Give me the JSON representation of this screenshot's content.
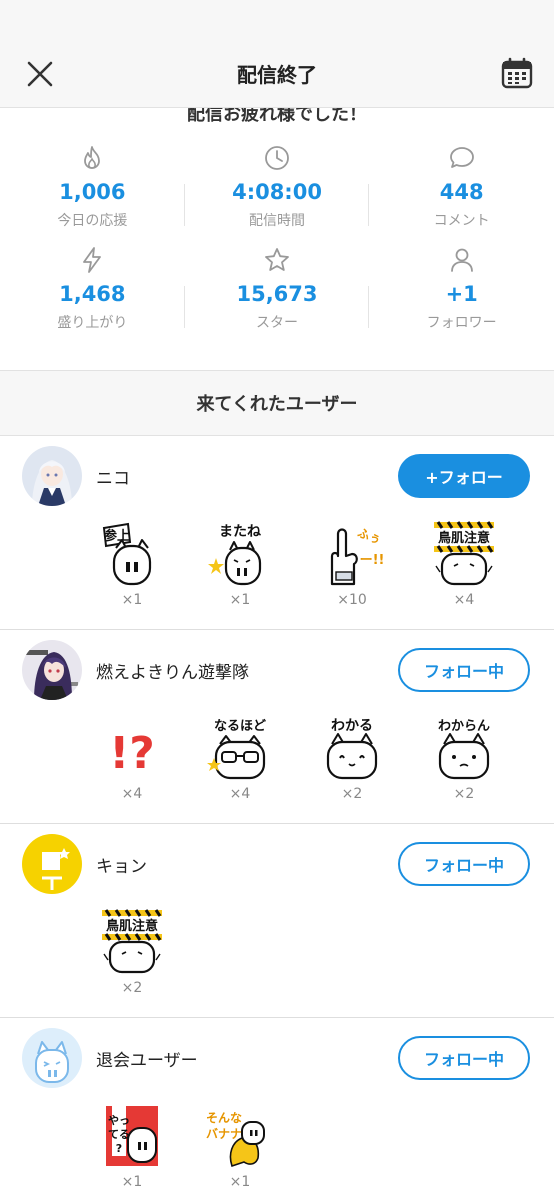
{
  "header": {
    "title": "配信終了"
  },
  "summary": {
    "banner": "配信お疲れ様でした！",
    "stats": [
      {
        "icon": "fire-icon",
        "value": "1,006",
        "label": "今日の応援"
      },
      {
        "icon": "clock-icon",
        "value": "4:08:00",
        "label": "配信時間"
      },
      {
        "icon": "comment-icon",
        "value": "448",
        "label": "コメント"
      },
      {
        "icon": "lightning-icon",
        "value": "1,468",
        "label": "盛り上がり"
      },
      {
        "icon": "star-icon",
        "value": "15,673",
        "label": "スター"
      },
      {
        "icon": "person-icon",
        "value": "+1",
        "label": "フォロワー"
      }
    ]
  },
  "visitors": {
    "title": "来てくれたユーザー",
    "users": [
      {
        "name": "ニコ",
        "follow_label": "+フォロー",
        "stickers": [
          {
            "name": "sticker-sanjou",
            "text": "参上",
            "count": "×1"
          },
          {
            "name": "sticker-matane",
            "text": "またね",
            "count": "×1"
          },
          {
            "name": "sticker-fuu",
            "text": "ふぅー!!",
            "count": "×10"
          },
          {
            "name": "sticker-torihada",
            "text": "鳥肌注意",
            "count": "×4"
          }
        ]
      },
      {
        "name": "燃えよきりん遊撃隊",
        "follow_label": "フォロー中",
        "stickers": [
          {
            "name": "sticker-exclaim",
            "text": "!?",
            "count": "×4"
          },
          {
            "name": "sticker-naruhodo",
            "text": "なるほど",
            "count": "×4"
          },
          {
            "name": "sticker-wakaru",
            "text": "わかる",
            "count": "×2"
          },
          {
            "name": "sticker-wakaran",
            "text": "わからん",
            "count": "×2"
          }
        ]
      },
      {
        "name": "キョン",
        "follow_label": "フォロー中",
        "stickers": [
          {
            "name": "sticker-torihada",
            "text": "鳥肌注意",
            "count": "×2"
          }
        ]
      },
      {
        "name": "退会ユーザー",
        "follow_label": "フォロー中",
        "stickers": [
          {
            "name": "sticker-yatteru",
            "text": "やってる?",
            "count": "×1"
          },
          {
            "name": "sticker-banana",
            "text": "そんなバナナ",
            "count": "×1"
          }
        ]
      }
    ]
  },
  "colors": {
    "accent": "#1a8fe0",
    "muted": "#9a9a9a",
    "sticker_red": "#e53935",
    "sticker_yellow": "#f5c518"
  }
}
